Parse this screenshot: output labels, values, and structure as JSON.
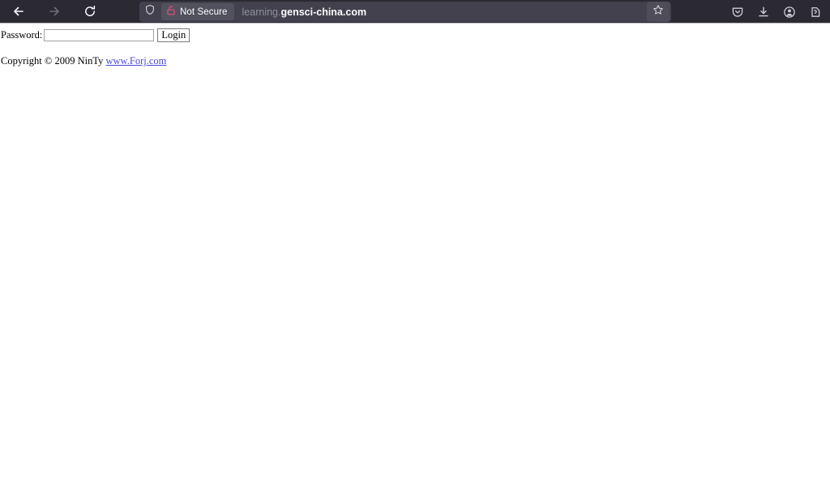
{
  "browser": {
    "nav": {
      "back_label": "Back",
      "back_icon": "arrow-left-icon",
      "back_enabled": true,
      "forward_label": "Forward",
      "forward_icon": "arrow-right-icon",
      "forward_enabled": false,
      "reload_label": "Reload",
      "reload_icon": "reload-icon"
    },
    "urlbar": {
      "shield_icon": "shield-icon",
      "security_badge_icon": "broken-lock-icon",
      "security_badge_label": "Not Secure",
      "security_badge_color": "#e0507c",
      "url_prefix": "learning.",
      "url_domain": "gensci-china.com",
      "full_url": "learning.gensci-china.com",
      "bookmark_icon": "star-icon",
      "bookmark_label": "Bookmark this page"
    },
    "toolbar_right": [
      {
        "name": "pocket-icon",
        "label": "Save to Pocket"
      },
      {
        "name": "download-icon",
        "label": "Downloads"
      },
      {
        "name": "account-icon",
        "label": "Account"
      },
      {
        "name": "extensions-icon",
        "label": "Extensions"
      }
    ],
    "colors": {
      "chrome_bg": "#2b2a33",
      "urlbar_bg": "#42414d",
      "badge_bg": "#52525e",
      "text": "#fbfbfe",
      "text_dim": "#8f8f9d"
    }
  },
  "page": {
    "form": {
      "password_label": "Password:",
      "password_value": "",
      "password_placeholder": "",
      "login_button_label": "Login"
    },
    "footer": {
      "copyright_text": "Copyright © 2009 NinTy ",
      "link_text": "www.Forj.com"
    }
  }
}
